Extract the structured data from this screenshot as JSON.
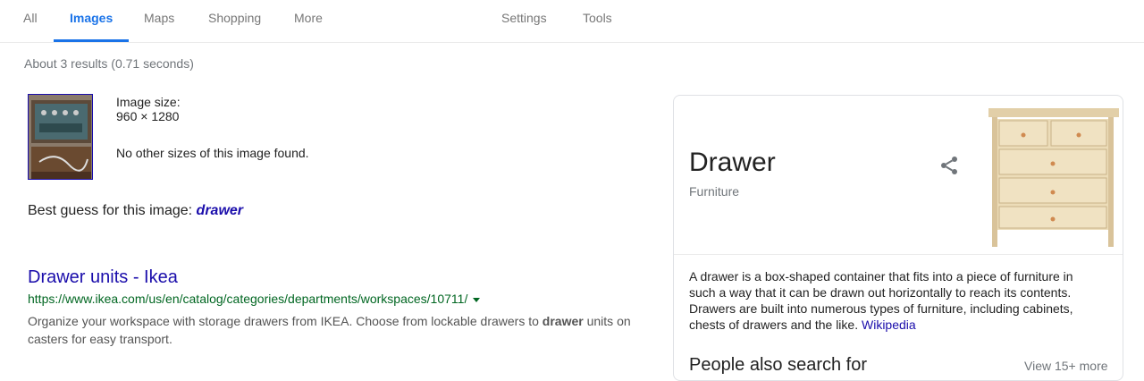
{
  "tabs": [
    {
      "label": "All"
    },
    {
      "label": "Images"
    },
    {
      "label": "Maps"
    },
    {
      "label": "Shopping"
    },
    {
      "label": "More"
    },
    {
      "label": "Settings"
    },
    {
      "label": "Tools"
    }
  ],
  "stats": "About 3 results (0.71 seconds)",
  "image_info": {
    "size_label": "Image size:",
    "size_value": "960 × 1280",
    "no_sizes": "No other sizes of this image found."
  },
  "best_guess": {
    "prefix": "Best guess for this image:",
    "term": "drawer"
  },
  "result": {
    "title": "Drawer units - Ikea",
    "url": "https://www.ikea.com/us/en/catalog/categories/departments/workspaces/10711/",
    "snippet_before": "Organize your workspace with storage drawers from IKEA. Choose from lockable drawers to ",
    "snippet_bold": "drawer",
    "snippet_after": " units on casters for easy transport."
  },
  "knowledge_panel": {
    "title": "Drawer",
    "subtitle": "Furniture",
    "description": "A drawer is a box-shaped container that fits into a piece of furniture in such a way that it can be drawn out horizontally to reach its contents. Drawers are built into numerous types of furniture, including cabinets, chests of drawers and the like.",
    "source_link": "Wikipedia",
    "people_also_search": "People also search for",
    "view_more": "View 15+ more"
  },
  "colors": {
    "accent": "#1a73e8",
    "link": "#1a0dab",
    "url_green": "#006621"
  }
}
